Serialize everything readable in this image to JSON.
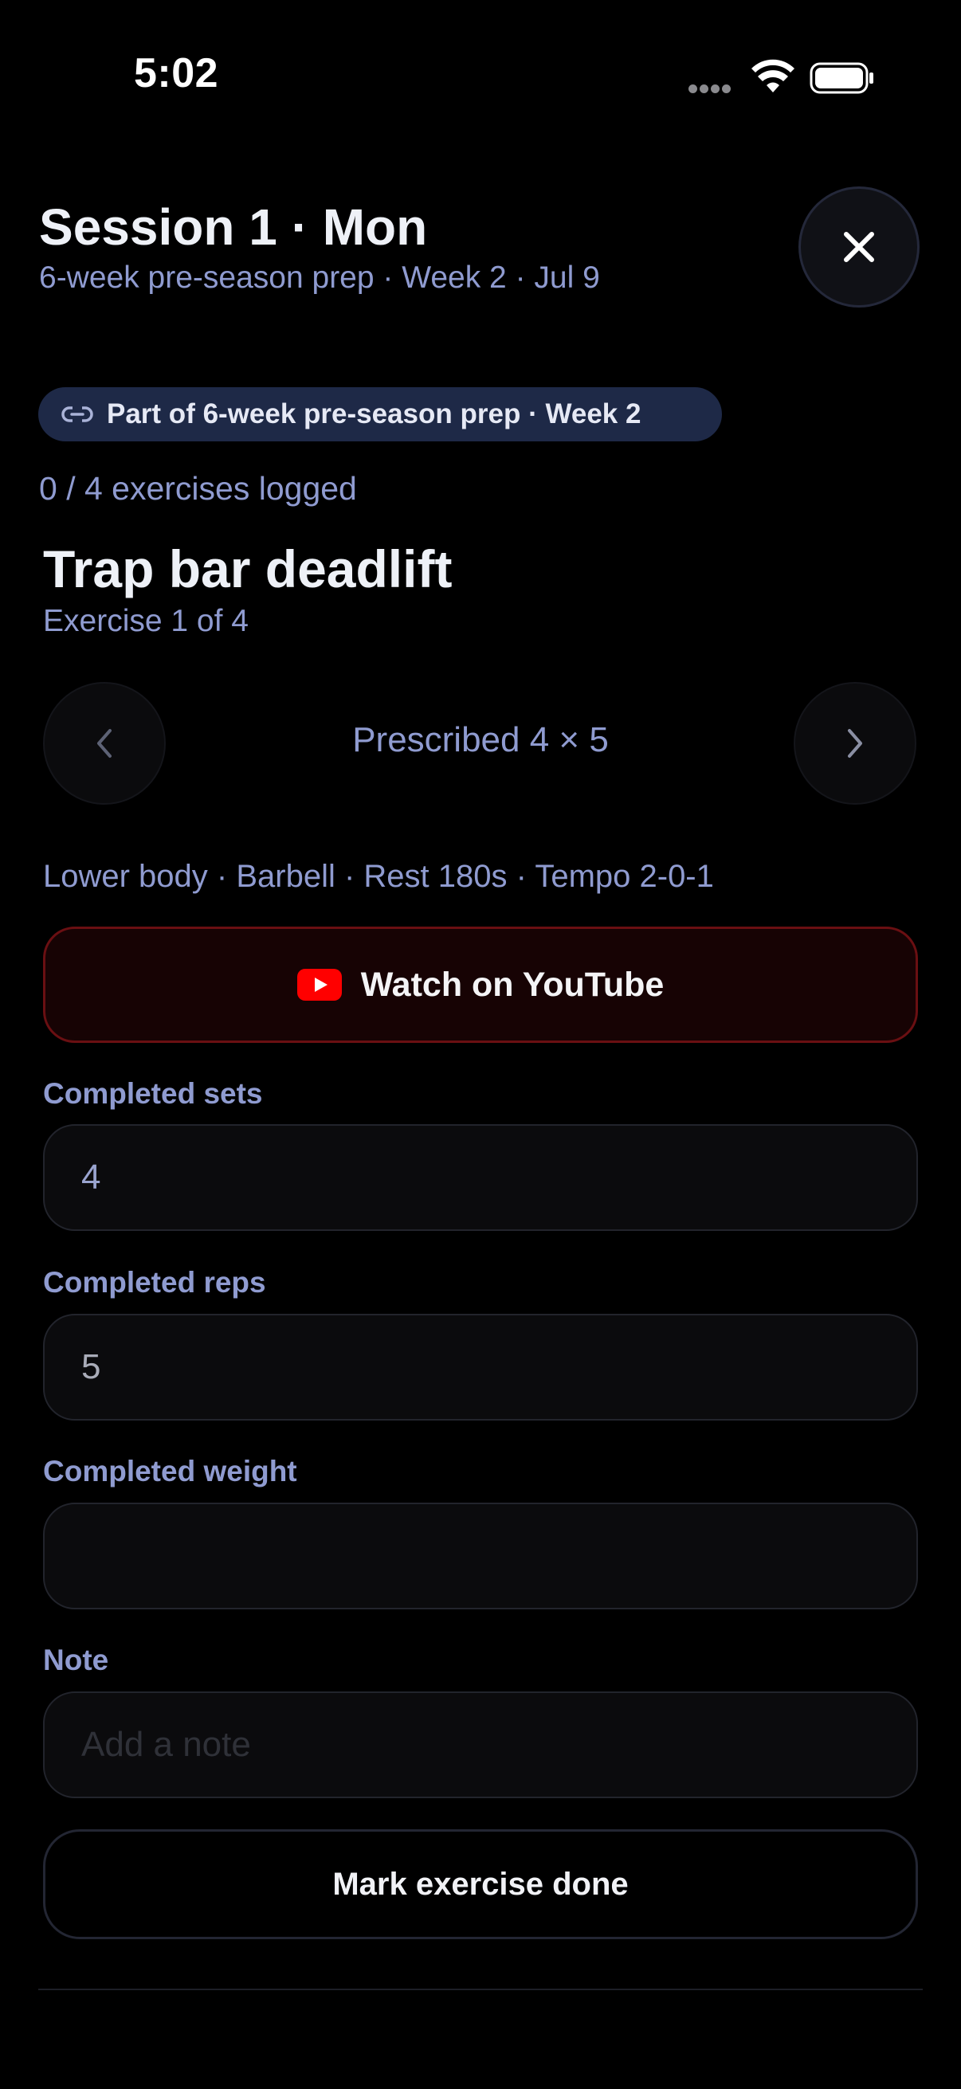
{
  "status_bar": {
    "time": "5:02"
  },
  "header": {
    "title": "Session 1 · Mon",
    "subtitle": "6-week pre-season prep · Week 2 · Jul 9",
    "close_icon": "close-icon"
  },
  "program_chip": {
    "icon": "link-icon",
    "label": "Part of 6-week pre-season prep · Week 2"
  },
  "progress": {
    "text": "0 / 4 exercises logged"
  },
  "exercise": {
    "name": "Trap bar deadlift",
    "index_text": "Exercise 1 of 4",
    "prescribed": "Prescribed 4 × 5",
    "meta": "Lower body · Barbell · Rest 180s · Tempo 2-0-1",
    "prev_icon": "chevron-left-icon",
    "next_icon": "chevron-right-icon"
  },
  "youtube": {
    "icon": "youtube-icon",
    "label": "Watch on YouTube",
    "accent": "#ff0000"
  },
  "fields": {
    "sets": {
      "label": "Completed sets",
      "value": "4"
    },
    "reps": {
      "label": "Completed reps",
      "value": "5"
    },
    "weight": {
      "label": "Completed weight",
      "value": ""
    },
    "note": {
      "label": "Note",
      "value": "",
      "placeholder": "Add a note"
    }
  },
  "actions": {
    "mark_done_label": "Mark exercise done"
  },
  "colors": {
    "background": "#000000",
    "muted_text": "#8f9bd0",
    "chip_background": "#1e2947",
    "youtube_border": "#6a0f12"
  }
}
